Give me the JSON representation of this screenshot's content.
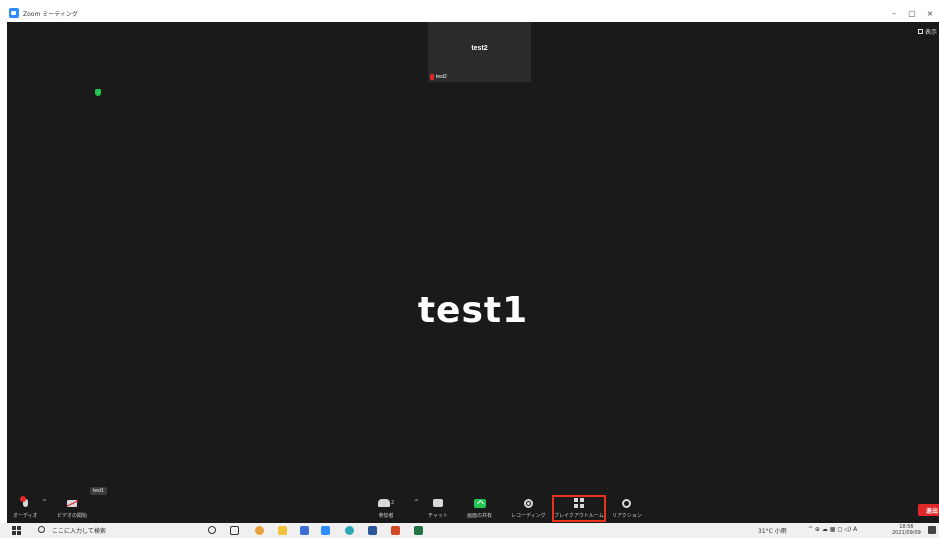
{
  "window": {
    "title": "Zoom ミーティング",
    "minimize": "–",
    "maximize": "▢",
    "close": "×"
  },
  "view_button": {
    "label": "表示"
  },
  "thumbnail": {
    "name": "test2",
    "label": "test2"
  },
  "main": {
    "speaker_name": "test1"
  },
  "tooltip": {
    "text": "test1"
  },
  "toolbar": {
    "audio_label": "オーディオ",
    "video_label": "ビデオの開始",
    "participants_label": "参加者",
    "participants_count": "2",
    "chat_label": "チャット",
    "share_label": "画面の共有",
    "record_label": "レコーディング",
    "breakout_label": "ブレイクアウトルーム",
    "reaction_label": "リアクション",
    "end_label": "退出",
    "caret": "^"
  },
  "taskbar": {
    "search_placeholder": "ここに入力して検索",
    "weather": "31°C 小雨",
    "tray_icons": "^ ⊕ ☁ ▦ ◻ ◁) A",
    "time": "18:56",
    "date": "2021/09/09"
  },
  "colors": {
    "meeting_bg": "#1a1a1a",
    "share_green": "#23c552",
    "end_red": "#e02828",
    "highlight": "#e8341c",
    "zoom_blue": "#2d8cff"
  }
}
